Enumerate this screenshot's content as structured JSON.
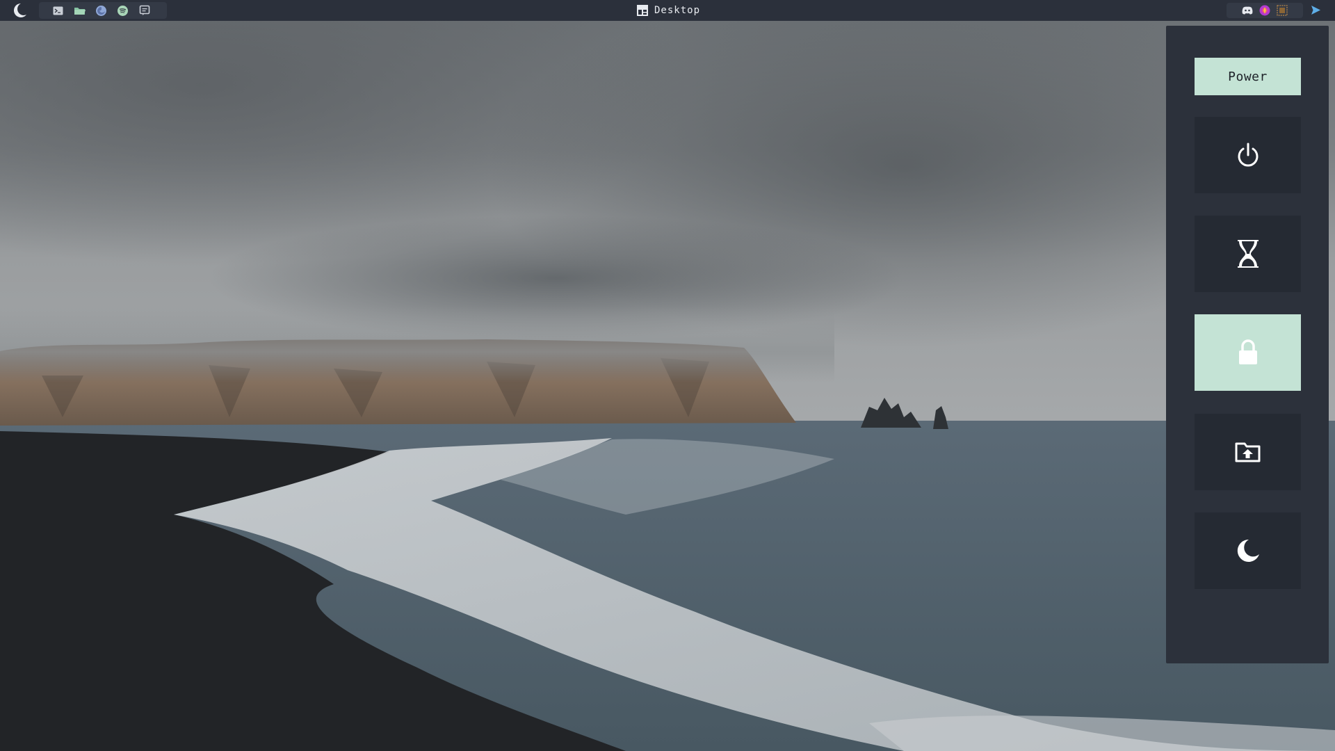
{
  "topbar": {
    "logo_icon": "crescent-moon-icon",
    "launcher_apps": [
      {
        "name": "terminal",
        "icon": "terminal-icon"
      },
      {
        "name": "files",
        "icon": "folder-icon"
      },
      {
        "name": "firefox",
        "icon": "firefox-icon"
      },
      {
        "name": "spotify",
        "icon": "spotify-icon"
      },
      {
        "name": "chat",
        "icon": "chat-icon"
      }
    ],
    "window_title": "Desktop",
    "window_icon": "layout-icon",
    "tray_icons": [
      "discord-icon",
      "picom-icon",
      "screenshot-icon"
    ],
    "notification_icon": "notification-icon"
  },
  "power_menu": {
    "title": "Power",
    "buttons": [
      {
        "action": "shutdown",
        "icon": "power-icon",
        "active": false
      },
      {
        "action": "suspend",
        "icon": "hourglass-icon",
        "active": false
      },
      {
        "action": "lock",
        "icon": "lock-icon",
        "active": true
      },
      {
        "action": "logout",
        "icon": "folder-upload-icon",
        "active": false
      },
      {
        "action": "sleep",
        "icon": "moon-icon",
        "active": false
      }
    ]
  },
  "colors": {
    "bar_bg": "#2b303b",
    "panel_bg": "#2c313b",
    "button_bg": "#252a33",
    "accent": "#c4e3d5"
  }
}
